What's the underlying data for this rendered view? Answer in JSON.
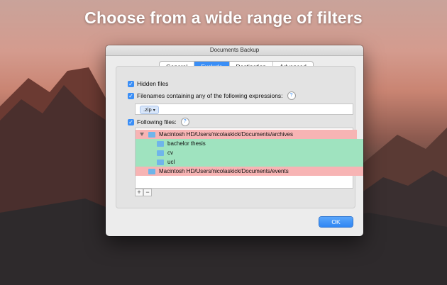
{
  "headline": "Choose from a wide range of filters",
  "window": {
    "title": "Documents Backup",
    "tabs": [
      {
        "label": "General",
        "active": false
      },
      {
        "label": "Exclude",
        "active": true
      },
      {
        "label": "Destination",
        "active": false
      },
      {
        "label": "Advanced",
        "active": false
      }
    ]
  },
  "options": {
    "hidden_files": {
      "label": "Hidden files",
      "checked": true
    },
    "filenames": {
      "label": "Filenames containing any of the following expressions:",
      "checked": true
    },
    "following_files": {
      "label": "Following files:",
      "checked": true
    }
  },
  "expression_tokens": [
    ".zip"
  ],
  "file_list": [
    {
      "label": "Macintosh HD/Users/nicolaskick/Documents/archives",
      "indent": 0,
      "status": "excluded",
      "expanded": true
    },
    {
      "label": "bachelor thesis",
      "indent": 1,
      "status": "included"
    },
    {
      "label": "cv",
      "indent": 1,
      "status": "included"
    },
    {
      "label": "ucl",
      "indent": 1,
      "status": "included"
    },
    {
      "label": "Macintosh HD/Users/nicolaskick/Documents/events",
      "indent": 0,
      "status": "excluded"
    }
  ],
  "buttons": {
    "add": "+",
    "remove": "−",
    "ok": "OK"
  },
  "colors": {
    "accent": "#3a8ef6",
    "excluded_row": "#f7b4b4",
    "included_row": "#9fe3bf",
    "folder": "#6fb5ea"
  },
  "icons": {
    "help": "?",
    "dropdown": "chevron-down-icon",
    "disclosure": "disclosure-triangle-icon"
  }
}
